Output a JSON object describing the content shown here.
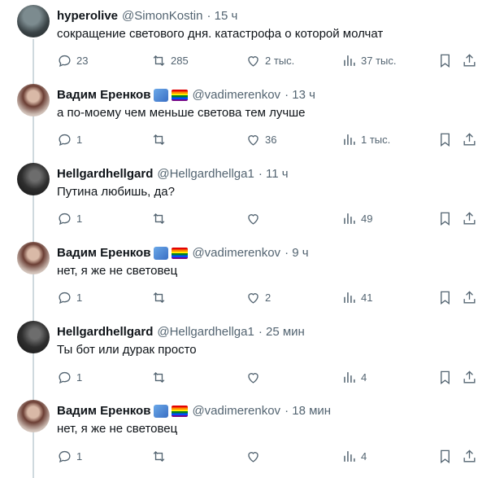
{
  "posts": [
    {
      "name": "hyperolive",
      "handle": "@SimonKostin",
      "time": "· 15 ч",
      "text": "сокращение светового дня. катастрофа о которой молчат",
      "avatar": "avatar-hyperolive",
      "badges": [],
      "replies": "23",
      "reposts": "285",
      "likes": "2 тыс.",
      "views": "37 тыс."
    },
    {
      "name": "Вадим Еренков",
      "handle": "@vadimerenkov",
      "time": "· 13 ч",
      "text": "а по-моему чем меньше светова тем лучше",
      "avatar": "avatar-vadim",
      "badges": [
        "people-emoji",
        "rainbow-flag-emoji"
      ],
      "replies": "1",
      "reposts": "",
      "likes": "36",
      "views": "1 тыс."
    },
    {
      "name": "Hellgardhellgard",
      "handle": "@Hellgardhellga1",
      "time": "· 11 ч",
      "text": "Путина любишь, да?",
      "avatar": "avatar-hellgard",
      "badges": [],
      "replies": "1",
      "reposts": "",
      "likes": "",
      "views": "49"
    },
    {
      "name": "Вадим Еренков",
      "handle": "@vadimerenkov",
      "time": "· 9 ч",
      "text": "нет, я же не световец",
      "avatar": "avatar-vadim",
      "badges": [
        "people-emoji",
        "rainbow-flag-emoji"
      ],
      "replies": "1",
      "reposts": "",
      "likes": "2",
      "views": "41"
    },
    {
      "name": "Hellgardhellgard",
      "handle": "@Hellgardhellga1",
      "time": "· 25 мин",
      "text": "Ты бот или дурак просто",
      "avatar": "avatar-hellgard",
      "badges": [],
      "replies": "1",
      "reposts": "",
      "likes": "",
      "views": "4"
    },
    {
      "name": "Вадим Еренков",
      "handle": "@vadimerenkov",
      "time": "· 18 мин",
      "text": "нет, я же не световец",
      "avatar": "avatar-vadim",
      "badges": [
        "people-emoji",
        "rainbow-flag-emoji"
      ],
      "replies": "1",
      "reposts": "",
      "likes": "",
      "views": "4"
    }
  ],
  "icons": {
    "reply": "reply-icon",
    "repost": "repost-icon",
    "like": "like-icon",
    "views": "views-icon",
    "bookmark": "bookmark-icon",
    "share": "share-icon"
  },
  "colors": {
    "text": "#0f1419",
    "secondary": "#536471",
    "thread_line": "#cfd9de"
  }
}
